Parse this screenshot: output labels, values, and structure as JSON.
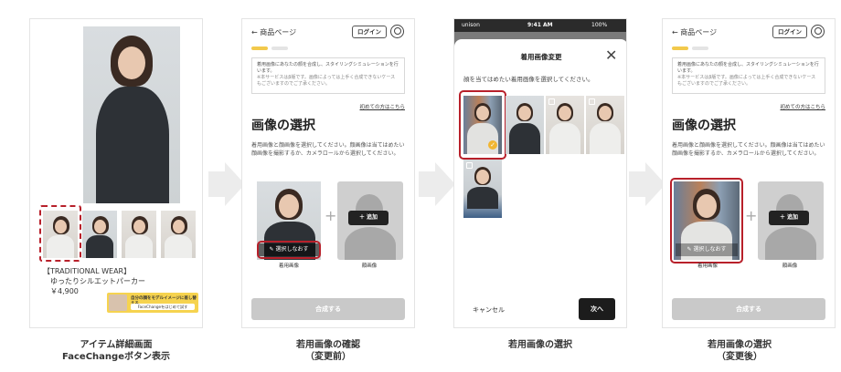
{
  "panel1": {
    "brand": "【TRADITIONAL WEAR】",
    "product_name": "ゆったりシルエットパーカー",
    "price": "￥4,900",
    "banner_text": "自分の顔をモデルイメージに差し替える",
    "banner_button": "FaceChangeをはじめて試す"
  },
  "screen": {
    "back_label": "商品ページ",
    "login_label": "ログイン",
    "notice_main": "着用画像にあなたの顔を合成し、スタイリングシミュレーションを行います。",
    "notice_sub": "※本サービスはβ版です。画像によっては上手く合成できないケースもございますのでご了承ください。",
    "first_time_link": "初めての方はこちら",
    "section_title": "画像の選択",
    "section_desc": "着用画像と顔画像を選択してください。顔画像は当てはめたい顔画像を撮影するか、カメラロールから選択してください。",
    "reselect_label": "選択しなおす",
    "add_label": "追加",
    "wear_label": "着用画像",
    "face_label": "顔画像",
    "submit_label": "合成する"
  },
  "modal": {
    "status_carrier": "unison",
    "status_time": "9:41 AM",
    "status_battery": "100%",
    "title": "着用画像変更",
    "description": "顔を当てはめたい着用画像を選択してください。",
    "cancel_label": "キャンセル",
    "next_label": "次へ"
  },
  "captions": {
    "c1_line1": "アイテム詳細画面",
    "c1_line2": "FaceChangeボタン表示",
    "c2_line1": "若用画像の確認",
    "c2_line2": "（変更前）",
    "c3_line1": "若用画像の選択",
    "c4_line1": "若用画像の選択",
    "c4_line2": "（変更後）"
  },
  "colors": {
    "highlight": "#b8202a",
    "step_active": "#f2c94c",
    "submit_disabled": "#c9c9c9"
  }
}
